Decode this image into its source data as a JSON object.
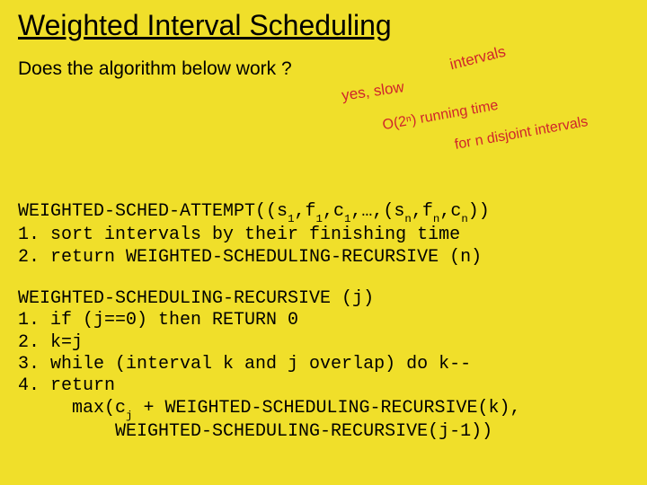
{
  "title": "Weighted Interval Scheduling",
  "question": "Does the algorithm below work ?",
  "annotations": {
    "a1": "yes, slow",
    "a2": "O(2ⁿ) running time",
    "a3": "for   n  disjoint intervals",
    "intervals": "intervals"
  },
  "code1": {
    "header_pre": "WEIGHTED-SCHED-ATTEMPT((s",
    "h_s1": "1",
    "h_mid1": ",f",
    "h_f1": "1",
    "h_mid2": ",c",
    "h_c1": "1",
    "h_mid3": ",…,(s",
    "h_sn": "n",
    "h_mid4": ",f",
    "h_fn": "n",
    "h_mid5": ",c",
    "h_cn": "n",
    "h_end": "))",
    "l1": "1. sort intervals by their finishing time",
    "l2": "2. return WEIGHTED-SCHEDULING-RECURSIVE (n)"
  },
  "code2": {
    "header": "WEIGHTED-SCHEDULING-RECURSIVE (j)",
    "l1": "1. if (j==0) then RETURN 0",
    "l2": "2. k=j",
    "l3": "3. while (interval k and j overlap) do k--",
    "l4": "4. return",
    "l5_pre": "     max(c",
    "l5_sub": "j",
    "l5_mid": " + WEIGHTED-SCHEDULING-RECURSIVE(k),",
    "l6": "         WEIGHTED-SCHEDULING-RECURSIVE(j-1))"
  }
}
